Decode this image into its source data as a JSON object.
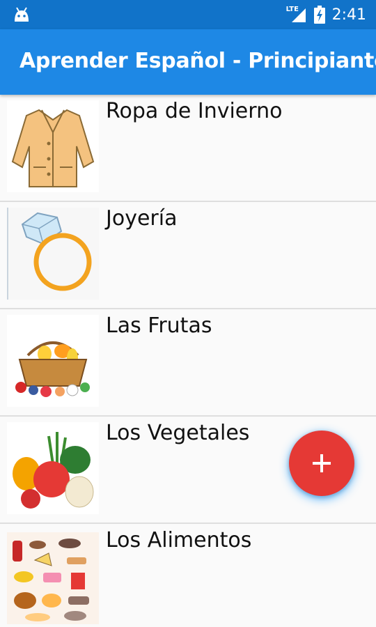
{
  "status_bar": {
    "time": "2:41",
    "network": "LTE",
    "icons": [
      "android-icon",
      "signal-icon",
      "battery-charging-icon"
    ]
  },
  "app_bar": {
    "title": "Aprender Español - Principiante"
  },
  "categories": [
    {
      "label": "Ropa de Invierno",
      "icon": "winter-coat-icon"
    },
    {
      "label": "Joyería",
      "icon": "diamond-ring-icon"
    },
    {
      "label": "Las Frutas",
      "icon": "fruit-basket-icon"
    },
    {
      "label": "Los Vegetales",
      "icon": "vegetables-icon"
    },
    {
      "label": "Los Alimentos",
      "icon": "foods-icon"
    }
  ],
  "fab": {
    "icon": "plus-icon",
    "color": "#e53935"
  },
  "colors": {
    "status_bar": "#1173c9",
    "app_bar": "#1e88e5",
    "background": "#fafafa"
  }
}
